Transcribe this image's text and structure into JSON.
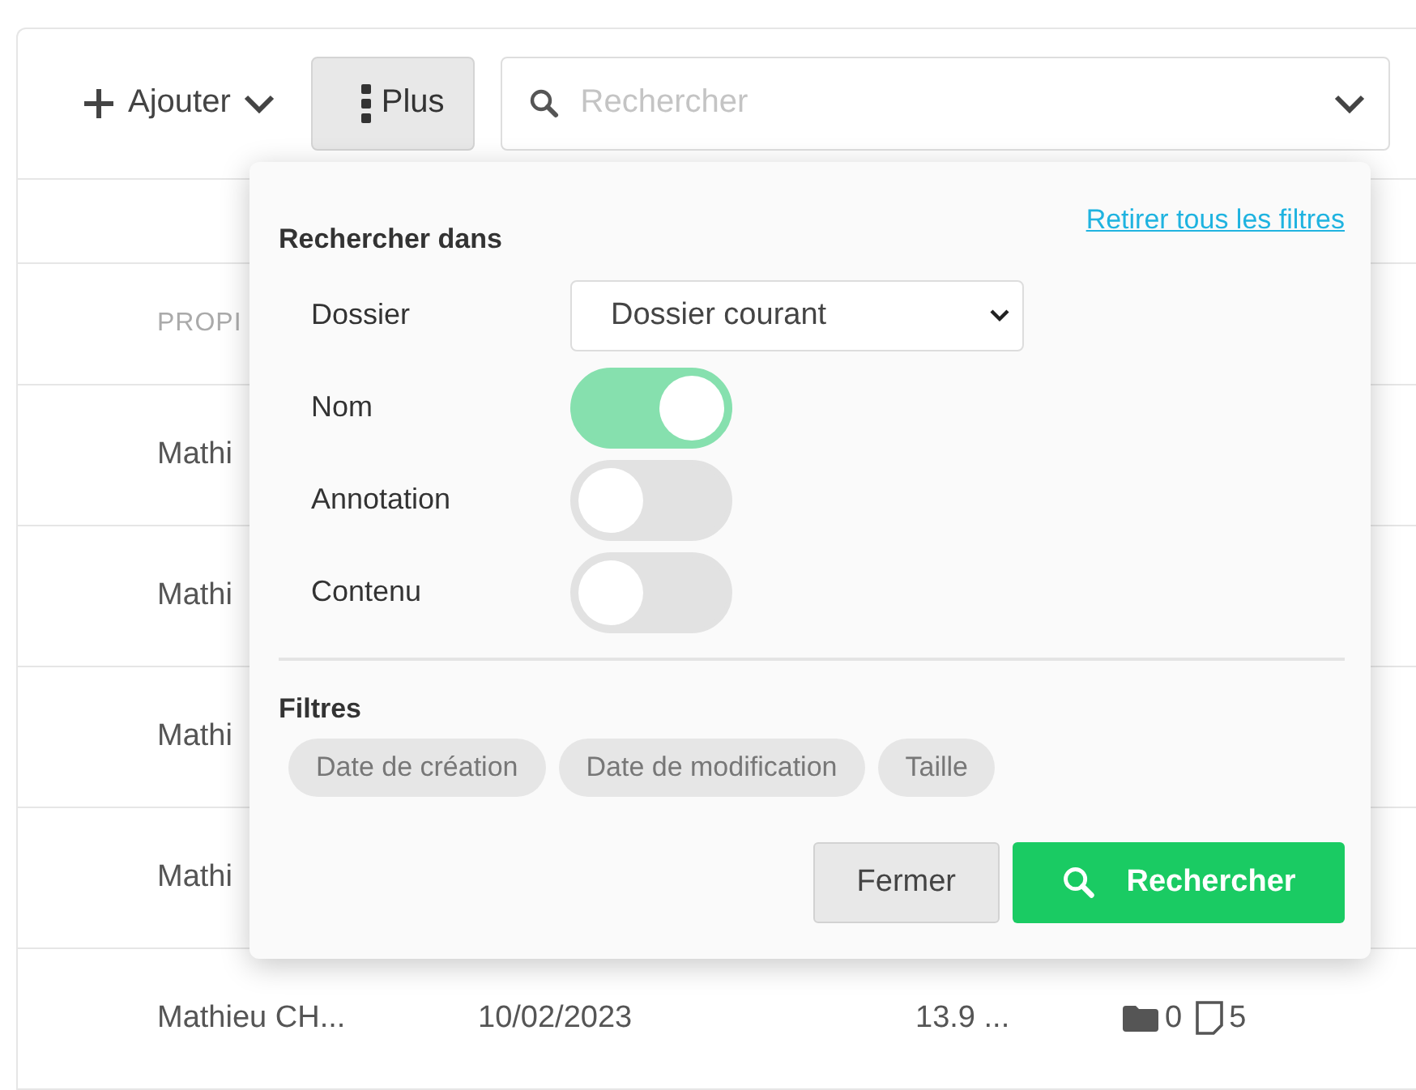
{
  "toolbar": {
    "add_label": "Ajouter",
    "more_label": "Plus",
    "search": {
      "placeholder": "Rechercher"
    }
  },
  "table": {
    "header": {
      "column_1": "PROPI"
    },
    "rows": [
      {
        "owner": "Mathi"
      },
      {
        "owner": "Mathi"
      },
      {
        "owner": "Mathi"
      },
      {
        "owner": "Mathi"
      },
      {
        "owner": "Mathieu CH...",
        "date": "10/02/2023",
        "size": "13.9 ...",
        "folders": "0",
        "files": "5"
      }
    ]
  },
  "search_panel": {
    "title": "Rechercher dans",
    "clear_link": "Retirer tous les filtres",
    "folder": {
      "label": "Dossier",
      "value": "Dossier courant"
    },
    "toggles": [
      {
        "label": "Nom",
        "on": true
      },
      {
        "label": "Annotation",
        "on": false
      },
      {
        "label": "Contenu",
        "on": false
      }
    ],
    "filters_title": "Filtres",
    "filters": [
      "Date de création",
      "Date de modification",
      "Taille"
    ],
    "buttons": {
      "close": "Fermer",
      "search": "Rechercher"
    }
  }
}
